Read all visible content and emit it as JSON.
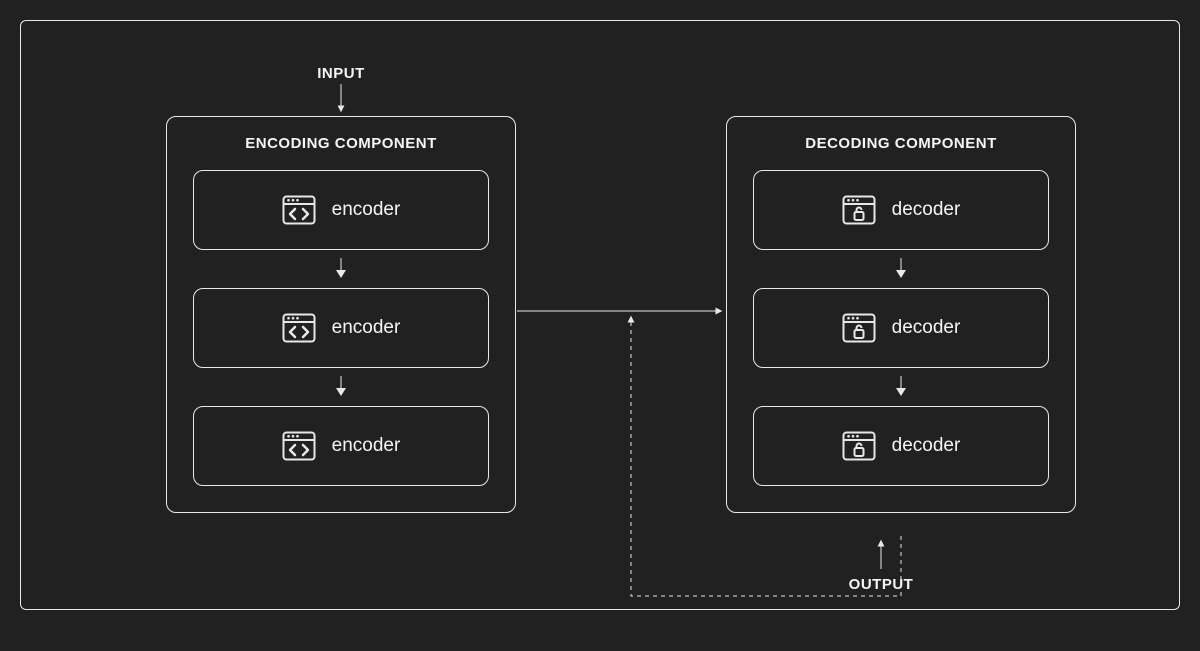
{
  "labels": {
    "input": "INPUT",
    "output": "OUTPUT"
  },
  "encoding": {
    "title": "ENCODING COMPONENT",
    "blocks": [
      "encoder",
      "encoder",
      "encoder"
    ]
  },
  "decoding": {
    "title": "DECODING COMPONENT",
    "blocks": [
      "decoder",
      "decoder",
      "decoder"
    ]
  },
  "colors": {
    "background": "#212121",
    "line": "#e8e8e8",
    "text": "#f5f5f5"
  }
}
